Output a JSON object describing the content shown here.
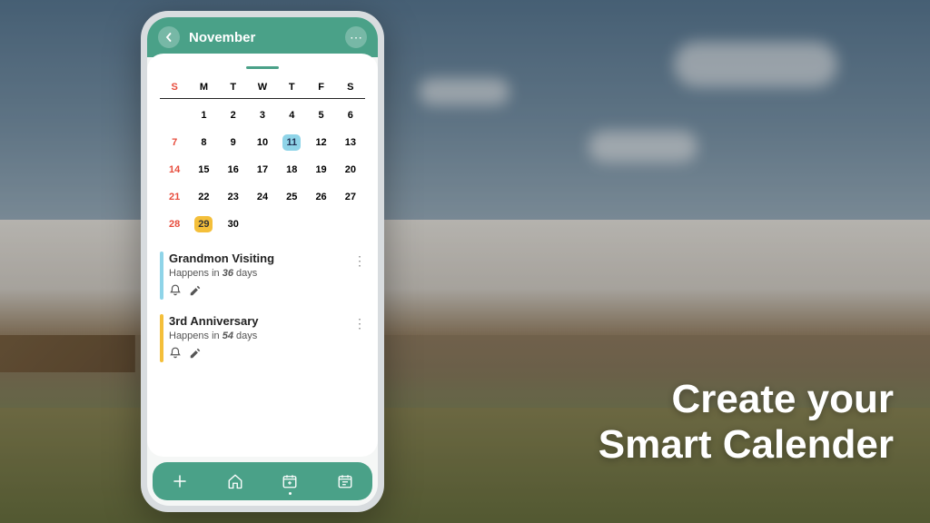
{
  "tagline": {
    "line1": "Create your",
    "line2": "Smart Calender"
  },
  "header": {
    "month": "November"
  },
  "calendar": {
    "dow": [
      "S",
      "M",
      "T",
      "W",
      "T",
      "F",
      "S"
    ],
    "weeks": [
      [
        "",
        "1",
        "2",
        "3",
        "4",
        "5",
        "6"
      ],
      [
        "7",
        "8",
        "9",
        "10",
        "11",
        "12",
        "13"
      ],
      [
        "14",
        "15",
        "16",
        "17",
        "18",
        "19",
        "20"
      ],
      [
        "21",
        "22",
        "23",
        "24",
        "25",
        "26",
        "27"
      ],
      [
        "28",
        "29",
        "30",
        "",
        "",
        "",
        ""
      ]
    ],
    "highlight_blue": "11",
    "highlight_yellow": "29"
  },
  "events": [
    {
      "title": "Grandmon Visiting",
      "prefix": "Happens in ",
      "count": "36",
      "suffix": " days",
      "color": "blue"
    },
    {
      "title": "3rd Anniversary",
      "prefix": "Happens in ",
      "count": "54",
      "suffix": " days",
      "color": "yellow"
    }
  ],
  "icons": {
    "bell": "bell-icon",
    "edit": "edit-icon",
    "plus": "plus-icon",
    "home": "home-icon",
    "cal_add": "calendar-add-icon",
    "cal_check": "calendar-check-icon"
  }
}
